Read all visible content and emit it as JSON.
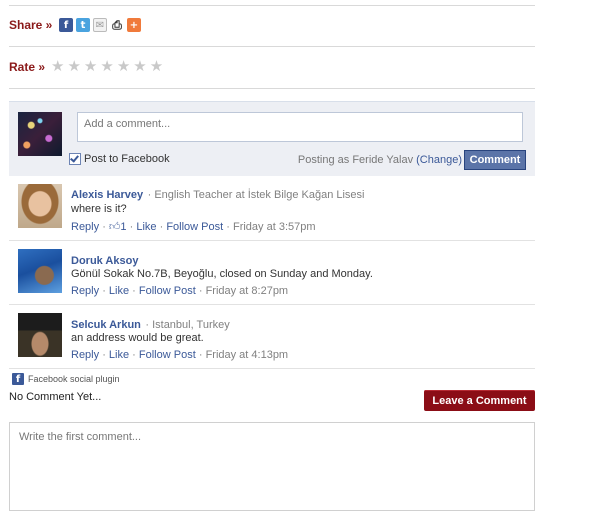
{
  "share": {
    "label": "Share »",
    "icons": [
      "facebook-icon",
      "twitter-icon",
      "email-icon",
      "print-icon",
      "addthis-icon"
    ]
  },
  "rate": {
    "label": "Rate »",
    "stars_total": 7,
    "stars_filled": 0
  },
  "composer": {
    "placeholder": "Add a comment...",
    "post_to_facebook": "Post to Facebook",
    "posting_as_prefix": "Posting as Feride Yalav",
    "change_label": "(Change)",
    "comment_button": "Comment"
  },
  "comments": [
    {
      "name": "Alexis Harvey",
      "meta": "· English Teacher at İstek Bilge Kağan Lisesi",
      "text": "where is it?",
      "reply": "Reply",
      "likes_count": "1",
      "like": "Like",
      "follow": "Follow Post",
      "time": "Friday at 3:57pm"
    },
    {
      "name": "Doruk Aksoy",
      "meta": "",
      "text": "Gönül Sokak No.7B, Beyoğlu, closed on Sunday and Monday.",
      "reply": "Reply",
      "like": "Like",
      "follow": "Follow Post",
      "time": "Friday at 8:27pm"
    },
    {
      "name": "Selcuk Arkun",
      "meta": "· Istanbul, Turkey",
      "text": "an address would be great.",
      "reply": "Reply",
      "like": "Like",
      "follow": "Follow Post",
      "time": "Friday at 4:13pm"
    }
  ],
  "plugin_label": "Facebook social plugin",
  "no_comment": "No Comment Yet...",
  "leave_comment": "Leave a Comment",
  "first_comment_placeholder": "Write the first comment...",
  "colors": {
    "accent_red": "#8b1a1a",
    "button_red": "#8b0d16",
    "fb_blue": "#3b5998"
  }
}
